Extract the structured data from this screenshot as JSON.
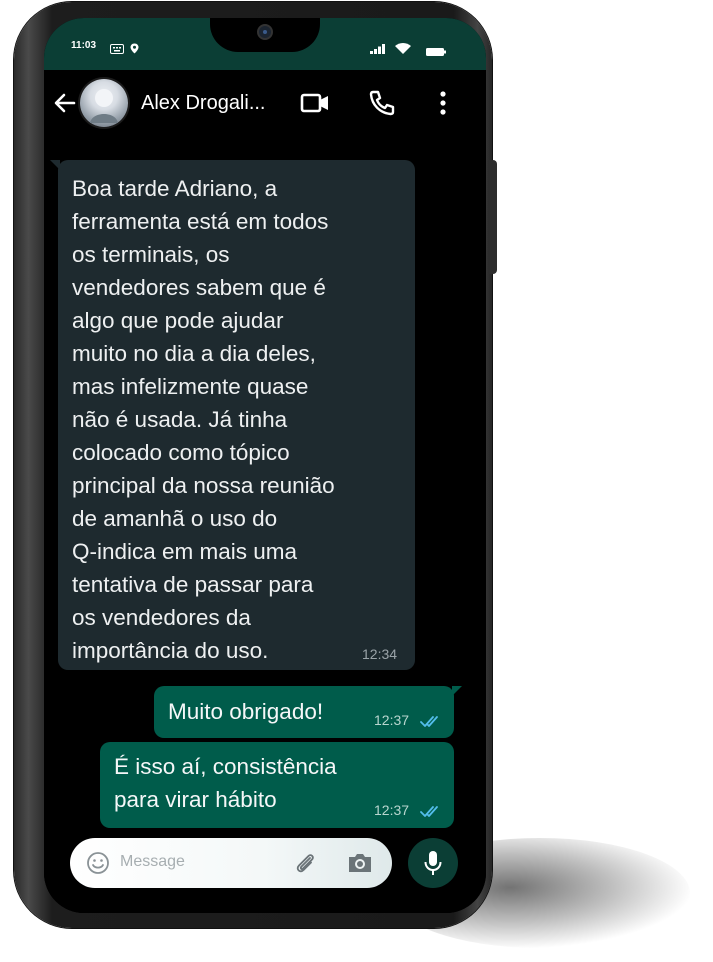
{
  "status_bar": {
    "time": "11:03"
  },
  "header": {
    "contact_name": "Alex Drogali..."
  },
  "messages": [
    {
      "direction": "incoming",
      "text": "Boa tarde Adriano, a\nferramenta está em todos\nos terminais, os\nvendedores sabem que é\nalgo que pode ajudar\nmuito no dia a dia deles,\nmas infelizmente quase\nnão é usada. Já tinha\ncolocado como tópico\nprincipal da nossa reunião\nde amanhã o uso do\nQ-indica em mais uma\ntentativa de passar para\nos vendedores da\nimportância do uso.",
      "time": "12:34"
    },
    {
      "direction": "outgoing",
      "text": "Muito obrigado!",
      "time": "12:37",
      "status": "read"
    },
    {
      "direction": "outgoing",
      "text": "É isso aí,  consistência\npara virar hábito",
      "time": "12:37",
      "status": "read"
    }
  ],
  "input": {
    "placeholder": "Message"
  },
  "icons": {
    "back": "arrow-left-icon",
    "video": "video-camera-icon",
    "call": "phone-icon",
    "menu": "more-vertical-icon",
    "emoji": "emoji-icon",
    "attach": "paperclip-icon",
    "camera": "camera-icon",
    "mic": "microphone-icon",
    "read": "double-check-icon"
  },
  "colors": {
    "header": "#0b3e35",
    "incoming_bubble": "#1e2a2f",
    "outgoing_bubble": "#005c4b",
    "read_ticks": "#53bdeb",
    "mic_button": "#0b3e35"
  }
}
